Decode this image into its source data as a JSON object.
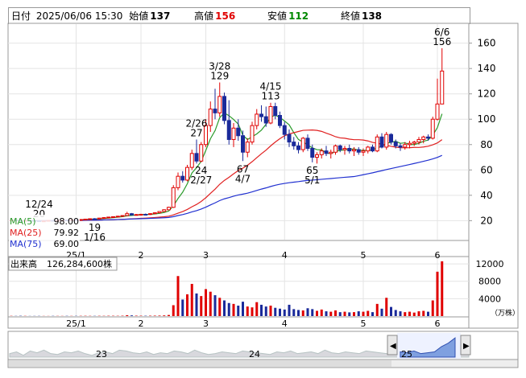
{
  "header": {
    "date_label": "日付",
    "date": "2025/06/06 15:30",
    "open_label": "始値",
    "open": "137",
    "high_label": "高値",
    "high": "156",
    "low_label": "安値",
    "low": "112",
    "close_label": "終値",
    "close": "138"
  },
  "legend": {
    "ma5": "MA(5)",
    "ma5_val": "98.00",
    "ma25": "MA(25)",
    "ma25_val": "79.92",
    "ma75": "MA(75)",
    "ma75_val": "69.00"
  },
  "volume_label": "出来高",
  "volume_value": "126,284,600株",
  "volume_unit": "（万株）",
  "colors": {
    "up": "#e00000",
    "down": "#1a2a9a",
    "ma5": "#2a9a2a",
    "ma25": "#e02020",
    "ma75": "#2030d0"
  },
  "chart_data": {
    "type": "candlestick",
    "price_axis": {
      "ticks": [
        "20",
        "40",
        "60",
        "80",
        "100",
        "120",
        "140",
        "160"
      ],
      "range": [
        5,
        175
      ]
    },
    "volume_axis": {
      "ticks": [
        "4000",
        "8000",
        "12000"
      ],
      "range": [
        0,
        13500
      ]
    },
    "x_ticks": [
      "25/1",
      "2",
      "3",
      "4",
      "5",
      "6"
    ],
    "navigator_ticks": [
      "23",
      "24",
      "25"
    ],
    "annotations": [
      {
        "label": "12/24",
        "value": "20"
      },
      {
        "label": "1/16",
        "value": "19"
      },
      {
        "label": "2/26",
        "value": "27"
      },
      {
        "label": "2/27",
        "value": "24"
      },
      {
        "label": "3/28",
        "value": "129"
      },
      {
        "label": "4/7",
        "value": "67"
      },
      {
        "label": "4/15",
        "value": "113"
      },
      {
        "label": "5/1",
        "value": "65"
      },
      {
        "label": "6/6",
        "value": "156"
      }
    ],
    "candles": [
      [
        20,
        21,
        19.5,
        20.5
      ],
      [
        20.5,
        21,
        19.6,
        20
      ],
      [
        20,
        20.6,
        19.4,
        19.8
      ],
      [
        19.8,
        20.4,
        19.3,
        20.2
      ],
      [
        20.2,
        20.8,
        19.8,
        20.1
      ],
      [
        20.1,
        20.6,
        19.6,
        19.9
      ],
      [
        19.9,
        20.3,
        19.2,
        19.6
      ],
      [
        19.6,
        20.1,
        19,
        19.8
      ],
      [
        19.8,
        20.4,
        19.4,
        20.2
      ],
      [
        20.2,
        20.6,
        19.8,
        20
      ],
      [
        20,
        20.5,
        19.6,
        20.3
      ],
      [
        20.3,
        20.9,
        20,
        20.5
      ],
      [
        20.5,
        21,
        20.1,
        20.4
      ],
      [
        20.4,
        21,
        20,
        20.8
      ],
      [
        20.8,
        21.2,
        20.3,
        20.6
      ],
      [
        20.6,
        21,
        20.2,
        20.9
      ],
      [
        20.9,
        21.5,
        20.6,
        21.2
      ],
      [
        21.2,
        21.8,
        20.8,
        21.5
      ],
      [
        21.5,
        22,
        21,
        21.3
      ],
      [
        21.3,
        22.2,
        21,
        22
      ],
      [
        22,
        22.6,
        21.6,
        22.4
      ],
      [
        22.4,
        23,
        22,
        22.8
      ],
      [
        22.8,
        23.4,
        22.3,
        23.1
      ],
      [
        23.1,
        23.8,
        22.8,
        23.5
      ],
      [
        23.5,
        24.2,
        23,
        24
      ],
      [
        24,
        27,
        23.6,
        25.5
      ],
      [
        25.5,
        26,
        24,
        24.5
      ],
      [
        24.5,
        25.2,
        24,
        24.8
      ],
      [
        24.8,
        25.4,
        24.2,
        25
      ],
      [
        25,
        25.6,
        24.4,
        24.9
      ],
      [
        24.9,
        25.8,
        24.5,
        25.5
      ],
      [
        25.5,
        26.5,
        25.2,
        26.2
      ],
      [
        26.2,
        27.5,
        25.8,
        27.2
      ],
      [
        27.2,
        29,
        26.8,
        28.6
      ],
      [
        28.6,
        31,
        28.2,
        30.5
      ],
      [
        30.5,
        48,
        30,
        46
      ],
      [
        46,
        58,
        44,
        55
      ],
      [
        55,
        59,
        50,
        52
      ],
      [
        52,
        64,
        51,
        62
      ],
      [
        62,
        76,
        60,
        73
      ],
      [
        73,
        84,
        65,
        67
      ],
      [
        67,
        82,
        66,
        80
      ],
      [
        80,
        100,
        78,
        95
      ],
      [
        95,
        114,
        90,
        108
      ],
      [
        108,
        124,
        100,
        105
      ],
      [
        105,
        129,
        102,
        118
      ],
      [
        118,
        121,
        96,
        99
      ],
      [
        99,
        115,
        80,
        84
      ],
      [
        84,
        97,
        78,
        93
      ],
      [
        93,
        100,
        83,
        87
      ],
      [
        87,
        91,
        67,
        74
      ],
      [
        74,
        85,
        70,
        82
      ],
      [
        82,
        98,
        80,
        95
      ],
      [
        95,
        108,
        92,
        104
      ],
      [
        104,
        111,
        98,
        102
      ],
      [
        102,
        110,
        94,
        97
      ],
      [
        97,
        113,
        96,
        110
      ],
      [
        110,
        113,
        100,
        103
      ],
      [
        103,
        106,
        93,
        95
      ],
      [
        95,
        98,
        84,
        88
      ],
      [
        88,
        92,
        78,
        82
      ],
      [
        82,
        86,
        76,
        79
      ],
      [
        79,
        82,
        73,
        76
      ],
      [
        76,
        86,
        74,
        85
      ],
      [
        85,
        88,
        75,
        77
      ],
      [
        77,
        80,
        66,
        70
      ],
      [
        70,
        74,
        65,
        72
      ],
      [
        72,
        77,
        69,
        75
      ],
      [
        75,
        79,
        71,
        73
      ],
      [
        73,
        76,
        69,
        74
      ],
      [
        74,
        80,
        72,
        79
      ],
      [
        79,
        80,
        74,
        76
      ],
      [
        76,
        79,
        72,
        77
      ],
      [
        77,
        80,
        73,
        75
      ],
      [
        75,
        78,
        71,
        76
      ],
      [
        76,
        78,
        72,
        74
      ],
      [
        74,
        77,
        71,
        75
      ],
      [
        75,
        79,
        73,
        78
      ],
      [
        78,
        80,
        74,
        75
      ],
      [
        75,
        88,
        74,
        86
      ],
      [
        86,
        89,
        77,
        78
      ],
      [
        78,
        90,
        76,
        88
      ],
      [
        88,
        89,
        80,
        82
      ],
      [
        82,
        84,
        77,
        79
      ],
      [
        79,
        81,
        75,
        78
      ],
      [
        78,
        82,
        76,
        80
      ],
      [
        80,
        83,
        77,
        81
      ],
      [
        81,
        83,
        79,
        82
      ],
      [
        82,
        86,
        80,
        84
      ],
      [
        84,
        87,
        81,
        86
      ],
      [
        86,
        88,
        83,
        85
      ],
      [
        85,
        102,
        84,
        100
      ],
      [
        100,
        132,
        99,
        112
      ],
      [
        112,
        156,
        112,
        138
      ]
    ],
    "volumes": [
      50,
      40,
      60,
      45,
      30,
      35,
      40,
      30,
      28,
      45,
      40,
      35,
      50,
      40,
      45,
      55,
      60,
      50,
      45,
      60,
      55,
      70,
      65,
      60,
      80,
      200,
      150,
      90,
      80,
      70,
      85,
      95,
      110,
      150,
      250,
      2500,
      9200,
      3800,
      5000,
      7400,
      5200,
      4600,
      6200,
      5600,
      4800,
      4200,
      3600,
      3000,
      2800,
      2400,
      3300,
      2200,
      2000,
      3200,
      2600,
      2200,
      2400,
      1900,
      1700,
      1500,
      2600,
      1600,
      1400,
      1300,
      1800,
      1600,
      1200,
      1500,
      1100,
      1000,
      1300,
      900,
      1000,
      850,
      900,
      1100,
      1000,
      1200,
      900,
      2800,
      1700,
      4200,
      2100,
      1400,
      1100,
      900,
      1000,
      800,
      1100,
      1200,
      1000,
      3600,
      10200,
      12600
    ],
    "navigator_series": [
      12,
      14,
      10,
      15,
      13,
      16,
      12,
      11,
      14,
      13,
      15,
      12,
      10,
      13,
      14,
      12,
      16,
      15,
      13,
      12,
      14,
      11,
      13,
      12,
      15,
      14,
      12,
      16,
      13,
      11,
      12,
      14,
      13,
      12,
      15,
      14,
      13,
      12,
      11,
      14,
      13,
      15,
      12,
      13,
      14,
      12,
      16,
      13,
      12,
      14,
      13,
      12,
      15,
      14,
      13,
      12,
      11,
      14,
      13,
      15,
      12,
      13,
      14,
      20,
      24,
      30,
      26,
      22
    ]
  }
}
